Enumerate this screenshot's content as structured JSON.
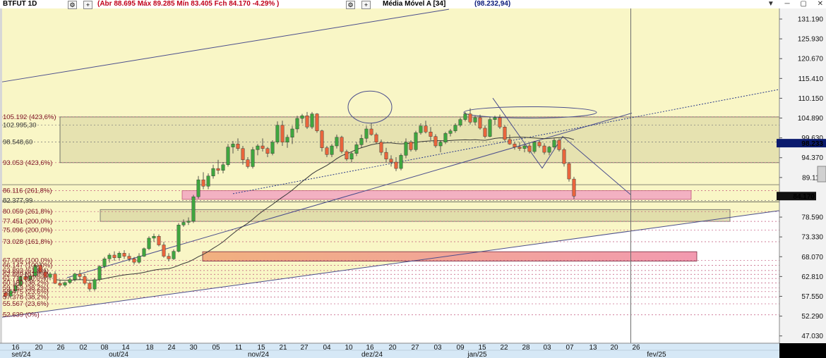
{
  "header": {
    "symbol": "BTFUT 1D",
    "ohlc_text": "(Abr 88.695 Máx 89.285 Mín 83.405 Fch 84.170 -4.29% )",
    "indicator_label": "Média Móvel A [34]",
    "indicator_value": "(98.232,94)",
    "buttons": [
      "⚙",
      "+"
    ],
    "window_controls": [
      "▼",
      "─",
      "▢",
      "✕"
    ]
  },
  "price_axis": {
    "ticks": [
      "131.190",
      "125.930",
      "120.670",
      "115.410",
      "110.150",
      "104.890",
      "99.630",
      "94.370",
      "89.110",
      "84.170",
      "78.590",
      "73.330",
      "68.070",
      "62.810",
      "57.550",
      "52.290",
      "47.030"
    ],
    "ma_box": "98.233",
    "last_box": "84.170",
    "time_box": "2h14"
  },
  "date_axis": {
    "days": [
      "16",
      "20",
      "26",
      "02",
      "08",
      "14",
      "18",
      "24",
      "30",
      "05",
      "11",
      "15",
      "21",
      "27",
      "04",
      "10",
      "16",
      "20",
      "27",
      "03",
      "09",
      "15",
      "22",
      "28",
      "03",
      "07",
      "13",
      "20",
      "26"
    ],
    "months": [
      "set/24",
      "out/24",
      "nov/24",
      "dez/24",
      "jan/25",
      "fev/25"
    ]
  },
  "level_labels": [
    {
      "text": "105.192 (423,6%)",
      "price": 105.19
    },
    {
      "text": "102.995,30",
      "price": 102.99
    },
    {
      "text": "98.548,60",
      "price": 98.55
    },
    {
      "text": "93.053 (423,6%)",
      "price": 93.05
    },
    {
      "text": "86.116 (261,8%)",
      "price": 85.6
    },
    {
      "text": "82.377,99",
      "price": 83.0
    },
    {
      "text": "80.059 (261,8%)",
      "price": 80.06
    },
    {
      "text": "77.451 (200,0%)",
      "price": 77.45
    },
    {
      "text": "75.096 (200,0%)",
      "price": 75.1
    },
    {
      "text": "73.028 (161,8%)",
      "price": 72.05
    },
    {
      "text": "67.065 (100,0%)",
      "price": 67.06
    },
    {
      "text": "66.147 (100,0%)",
      "price": 65.8
    },
    {
      "text": "63.893 (61,8%)",
      "price": 64.4
    },
    {
      "text": "62.889 (61,8%)",
      "price": 63.4
    },
    {
      "text": "61.711 (50,0%)",
      "price": 62.3
    },
    {
      "text": "60.180 (38,2%)",
      "price": 61.1
    },
    {
      "text": "59.153 (38,2%)",
      "price": 59.8
    },
    {
      "text": "58.475 (23,6%)",
      "price": 58.8
    },
    {
      "text": "57.378 (38,2%)",
      "price": 57.38
    },
    {
      "text": "55.567 (23,6%)",
      "price": 55.57
    },
    {
      "text": "52.639 (0%)",
      "price": 52.64
    }
  ],
  "colors": {
    "background": "#f9f6c6",
    "axis_background": "#fffde6",
    "pink_zone": "#f2a5c1",
    "orange_zone": "#f1b07f",
    "olive_zone": "#d8d6a2",
    "up_candle": "#3fa53f",
    "down_candle": "#e8643c",
    "trendline": "#4b4e8c",
    "moving_average": "#3a3a3a"
  },
  "chart_data": {
    "type": "candlestick",
    "title": "BTFUT 1D",
    "ylim": [
      45.1,
      134.0
    ],
    "series": [
      {
        "name": "BTFUT 1D",
        "candles": [
          [
            58.5,
            59.0,
            56.8,
            57.6
          ],
          [
            57.6,
            59.5,
            57.0,
            59.0
          ],
          [
            59.0,
            61.2,
            58.5,
            60.4
          ],
          [
            60.4,
            63.0,
            60.0,
            62.8
          ],
          [
            62.8,
            64.0,
            61.6,
            62.0
          ],
          [
            62.0,
            63.8,
            61.0,
            63.0
          ],
          [
            63.0,
            66.2,
            62.5,
            65.8
          ],
          [
            65.8,
            66.5,
            63.5,
            64.0
          ],
          [
            64.0,
            65.0,
            62.0,
            62.6
          ],
          [
            62.6,
            64.0,
            61.8,
            63.5
          ],
          [
            63.5,
            64.2,
            60.8,
            61.0
          ],
          [
            61.0,
            62.0,
            60.0,
            60.5
          ],
          [
            60.5,
            61.5,
            60.0,
            61.2
          ],
          [
            61.2,
            62.5,
            60.8,
            62.0
          ],
          [
            62.0,
            63.8,
            61.5,
            63.5
          ],
          [
            63.5,
            64.5,
            62.0,
            62.8
          ],
          [
            62.8,
            63.5,
            60.5,
            61.0
          ],
          [
            61.0,
            61.5,
            58.8,
            59.5
          ],
          [
            59.5,
            62.5,
            59.0,
            62.0
          ],
          [
            62.0,
            65.8,
            61.5,
            65.5
          ],
          [
            65.5,
            68.0,
            65.0,
            67.5
          ],
          [
            67.5,
            69.0,
            66.5,
            68.5
          ],
          [
            68.5,
            69.5,
            67.0,
            67.8
          ],
          [
            67.8,
            69.5,
            67.2,
            69.0
          ],
          [
            69.0,
            69.8,
            67.5,
            68.2
          ],
          [
            68.2,
            69.0,
            66.8,
            67.5
          ],
          [
            67.5,
            68.0,
            66.0,
            66.6
          ],
          [
            66.6,
            69.0,
            66.2,
            68.2
          ],
          [
            68.2,
            70.5,
            68.0,
            70.2
          ],
          [
            70.2,
            73.5,
            69.8,
            73.0
          ],
          [
            73.0,
            74.2,
            72.0,
            73.5
          ],
          [
            73.5,
            74.0,
            70.8,
            71.2
          ],
          [
            71.2,
            72.0,
            67.8,
            68.2
          ],
          [
            68.2,
            69.0,
            66.8,
            67.5
          ],
          [
            67.5,
            70.0,
            67.2,
            69.5
          ],
          [
            69.5,
            77.0,
            69.2,
            76.5
          ],
          [
            76.5,
            78.0,
            76.0,
            77.2
          ],
          [
            77.2,
            78.5,
            76.5,
            77.5
          ],
          [
            77.5,
            84.5,
            77.0,
            84.0
          ],
          [
            84.0,
            89.5,
            83.5,
            88.5
          ],
          [
            88.5,
            90.5,
            86.0,
            86.8
          ],
          [
            86.8,
            90.2,
            86.0,
            89.5
          ],
          [
            89.5,
            92.5,
            88.8,
            91.5
          ],
          [
            91.5,
            93.8,
            90.0,
            91.0
          ],
          [
            91.0,
            93.2,
            90.2,
            92.5
          ],
          [
            92.5,
            98.0,
            92.0,
            97.2
          ],
          [
            97.2,
            98.8,
            95.5,
            98.0
          ],
          [
            98.0,
            99.5,
            96.2,
            96.8
          ],
          [
            96.8,
            97.5,
            92.5,
            93.8
          ],
          [
            93.8,
            94.5,
            91.5,
            92.0
          ],
          [
            92.0,
            97.2,
            91.5,
            96.5
          ],
          [
            96.5,
            98.0,
            95.0,
            97.5
          ],
          [
            97.5,
            99.5,
            96.0,
            96.8
          ],
          [
            96.8,
            97.2,
            94.5,
            95.5
          ],
          [
            95.5,
            99.0,
            95.0,
            98.5
          ],
          [
            98.5,
            104.0,
            98.0,
            103.0
          ],
          [
            103.0,
            104.2,
            97.5,
            98.5
          ],
          [
            98.5,
            100.5,
            97.0,
            99.8
          ],
          [
            99.8,
            102.8,
            98.0,
            102.0
          ],
          [
            102.0,
            105.5,
            101.0,
            104.8
          ],
          [
            104.8,
            106.0,
            103.5,
            105.5
          ],
          [
            105.5,
            106.5,
            102.0,
            102.5
          ],
          [
            102.5,
            106.5,
            102.0,
            106.0
          ],
          [
            106.0,
            106.2,
            101.0,
            101.5
          ],
          [
            101.5,
            101.8,
            96.0,
            97.0
          ],
          [
            97.0,
            97.5,
            94.5,
            95.2
          ],
          [
            95.2,
            98.0,
            94.5,
            97.5
          ],
          [
            97.5,
            100.5,
            96.8,
            99.8
          ],
          [
            99.8,
            100.2,
            95.5,
            96.0
          ],
          [
            96.0,
            96.5,
            93.5,
            94.0
          ],
          [
            94.0,
            96.0,
            93.2,
            95.5
          ],
          [
            95.5,
            98.5,
            94.8,
            97.8
          ],
          [
            97.8,
            100.5,
            97.0,
            99.5
          ],
          [
            99.5,
            102.8,
            98.5,
            102.0
          ],
          [
            102.0,
            103.5,
            100.2,
            100.5
          ],
          [
            100.5,
            101.0,
            98.0,
            98.5
          ],
          [
            98.5,
            99.2,
            95.0,
            95.8
          ],
          [
            95.8,
            97.0,
            93.2,
            94.0
          ],
          [
            94.0,
            95.0,
            92.0,
            93.2
          ],
          [
            93.2,
            94.5,
            90.8,
            91.5
          ],
          [
            91.5,
            95.5,
            91.0,
            95.0
          ],
          [
            95.0,
            99.5,
            94.2,
            98.5
          ],
          [
            98.5,
            99.0,
            96.0,
            96.5
          ],
          [
            96.5,
            101.5,
            96.0,
            101.0
          ],
          [
            101.0,
            103.5,
            100.5,
            102.8
          ],
          [
            102.8,
            104.2,
            100.8,
            101.2
          ],
          [
            101.2,
            102.5,
            99.0,
            100.0
          ],
          [
            100.0,
            100.6,
            97.0,
            97.5
          ],
          [
            97.5,
            99.0,
            95.8,
            98.5
          ],
          [
            98.5,
            101.2,
            98.0,
            100.8
          ],
          [
            100.8,
            102.0,
            100.0,
            101.5
          ],
          [
            101.5,
            103.5,
            101.0,
            103.0
          ],
          [
            103.0,
            105.0,
            102.5,
            104.5
          ],
          [
            104.5,
            106.5,
            104.0,
            106.0
          ],
          [
            106.0,
            107.5,
            103.2,
            103.8
          ],
          [
            103.8,
            105.5,
            103.0,
            105.0
          ],
          [
            105.0,
            105.8,
            101.8,
            102.2
          ],
          [
            102.2,
            103.0,
            99.5,
            100.0
          ],
          [
            100.0,
            105.2,
            99.8,
            104.5
          ],
          [
            104.5,
            105.5,
            103.0,
            105.0
          ],
          [
            105.0,
            105.8,
            102.0,
            102.5
          ],
          [
            102.5,
            103.0,
            98.8,
            99.2
          ],
          [
            99.2,
            100.5,
            97.8,
            98.0
          ],
          [
            98.0,
            98.5,
            96.5,
            97.2
          ],
          [
            97.2,
            98.5,
            96.2,
            96.8
          ],
          [
            96.8,
            98.0,
            95.8,
            97.5
          ],
          [
            97.5,
            98.2,
            95.5,
            96.0
          ],
          [
            96.0,
            98.8,
            95.5,
            98.5
          ],
          [
            98.5,
            99.0,
            97.0,
            97.5
          ],
          [
            97.5,
            98.2,
            95.2,
            95.8
          ],
          [
            95.8,
            97.5,
            95.0,
            97.2
          ],
          [
            97.2,
            99.5,
            96.8,
            99.0
          ],
          [
            99.0,
            99.5,
            96.0,
            96.5
          ],
          [
            96.5,
            97.0,
            92.0,
            92.8
          ],
          [
            92.8,
            93.2,
            88.0,
            88.7
          ],
          [
            88.695,
            89.285,
            83.405,
            84.17
          ]
        ]
      },
      {
        "name": "Média Móvel A [34]"
      }
    ]
  }
}
